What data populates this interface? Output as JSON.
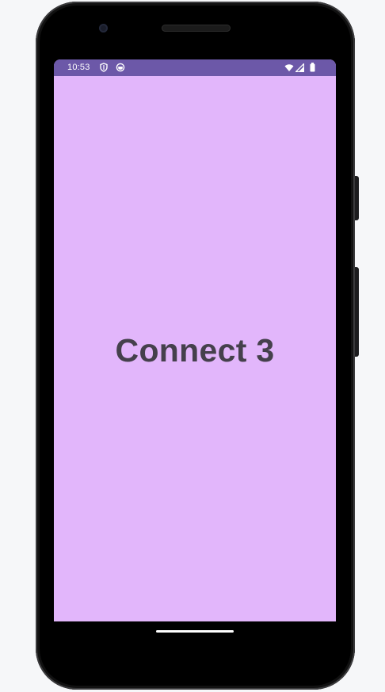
{
  "status_bar": {
    "time": "10:53",
    "left_icons": [
      "shield-icon",
      "vpn-key-circle-icon"
    ],
    "right_icons": [
      "wifi-icon",
      "cellular-signal-icon",
      "battery-icon"
    ],
    "background_color": "#6c58a8"
  },
  "app": {
    "title": "Connect 3",
    "background_color": "#e2b6fb",
    "title_color": "#45404c"
  },
  "navigation": {
    "gesture_handle": "home-gesture-bar"
  }
}
